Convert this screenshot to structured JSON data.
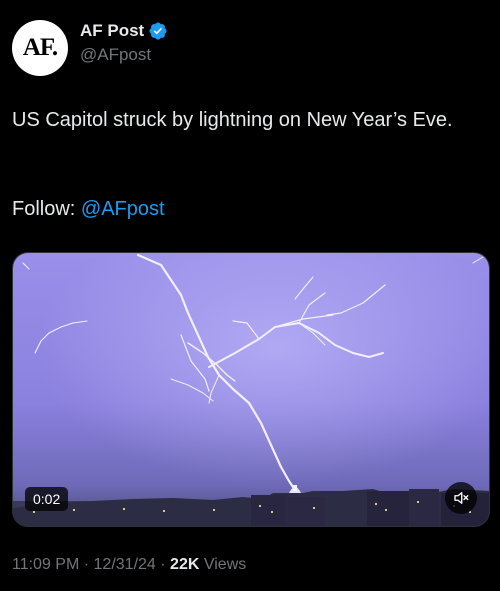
{
  "author": {
    "avatar_text": "AF.",
    "name": "AF Post",
    "handle": "@AFpost",
    "verified_color": "#1d9bf0"
  },
  "tweet": {
    "text": "US Capitol struck by lightning on New Year’s Eve.",
    "follow_prefix": "Follow: ",
    "follow_mention": "@AFpost"
  },
  "media": {
    "timestamp": "0:02",
    "mute_icon": "speaker-muted-icon",
    "sky_color": "#8a80de"
  },
  "meta": {
    "time": "11:09 PM",
    "date": "12/31/24",
    "separator": "·",
    "views_count": "22K",
    "views_label": "Views"
  }
}
